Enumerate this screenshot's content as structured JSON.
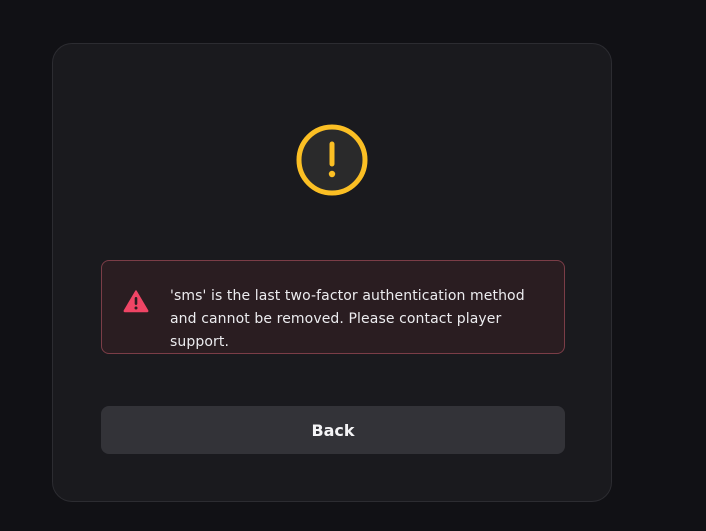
{
  "dialog": {
    "status_icon": "warning-circle-icon",
    "alert": {
      "icon": "warning-triangle-icon",
      "message": "'sms' is the last two-factor authentication method and cannot be removed. Please contact player support."
    },
    "back_label": "Back"
  },
  "colors": {
    "page_background": "#111115",
    "card_background": "#1a1a1e",
    "warning_yellow": "#fbbf24",
    "error_red": "#ef4565",
    "alert_background": "#2a1d21",
    "alert_border": "#7b3d47",
    "button_background": "#333338"
  }
}
